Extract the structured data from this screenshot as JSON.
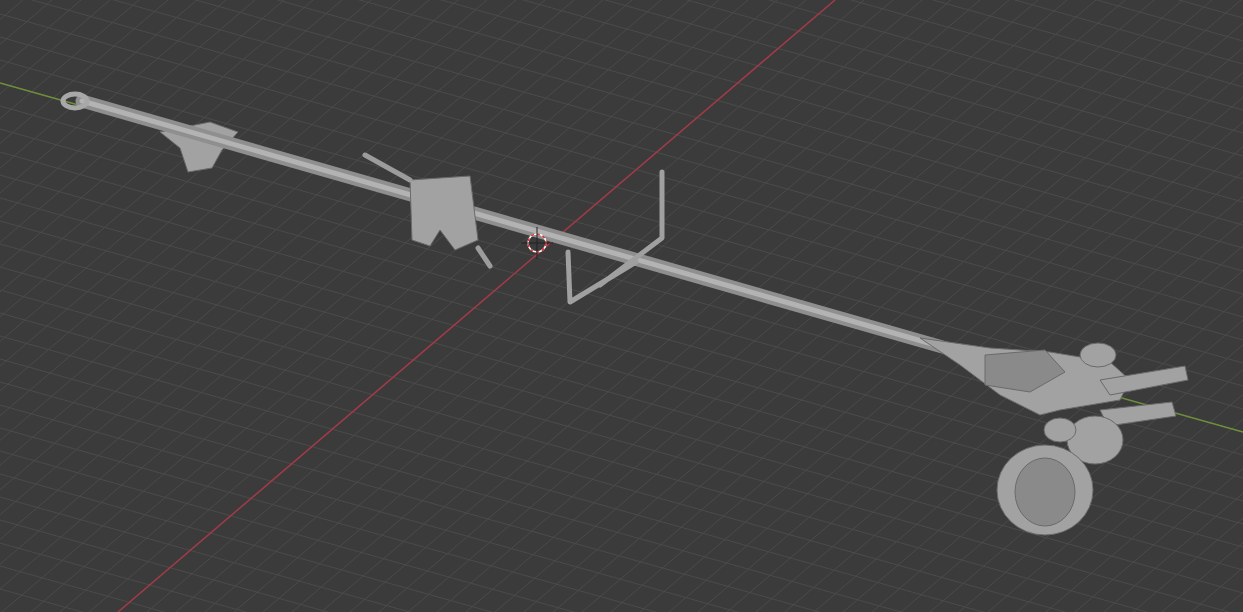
{
  "viewport": {
    "overlays": {
      "grid": true,
      "x_axis": true,
      "y_axis": true,
      "cursor_3d": true
    }
  }
}
